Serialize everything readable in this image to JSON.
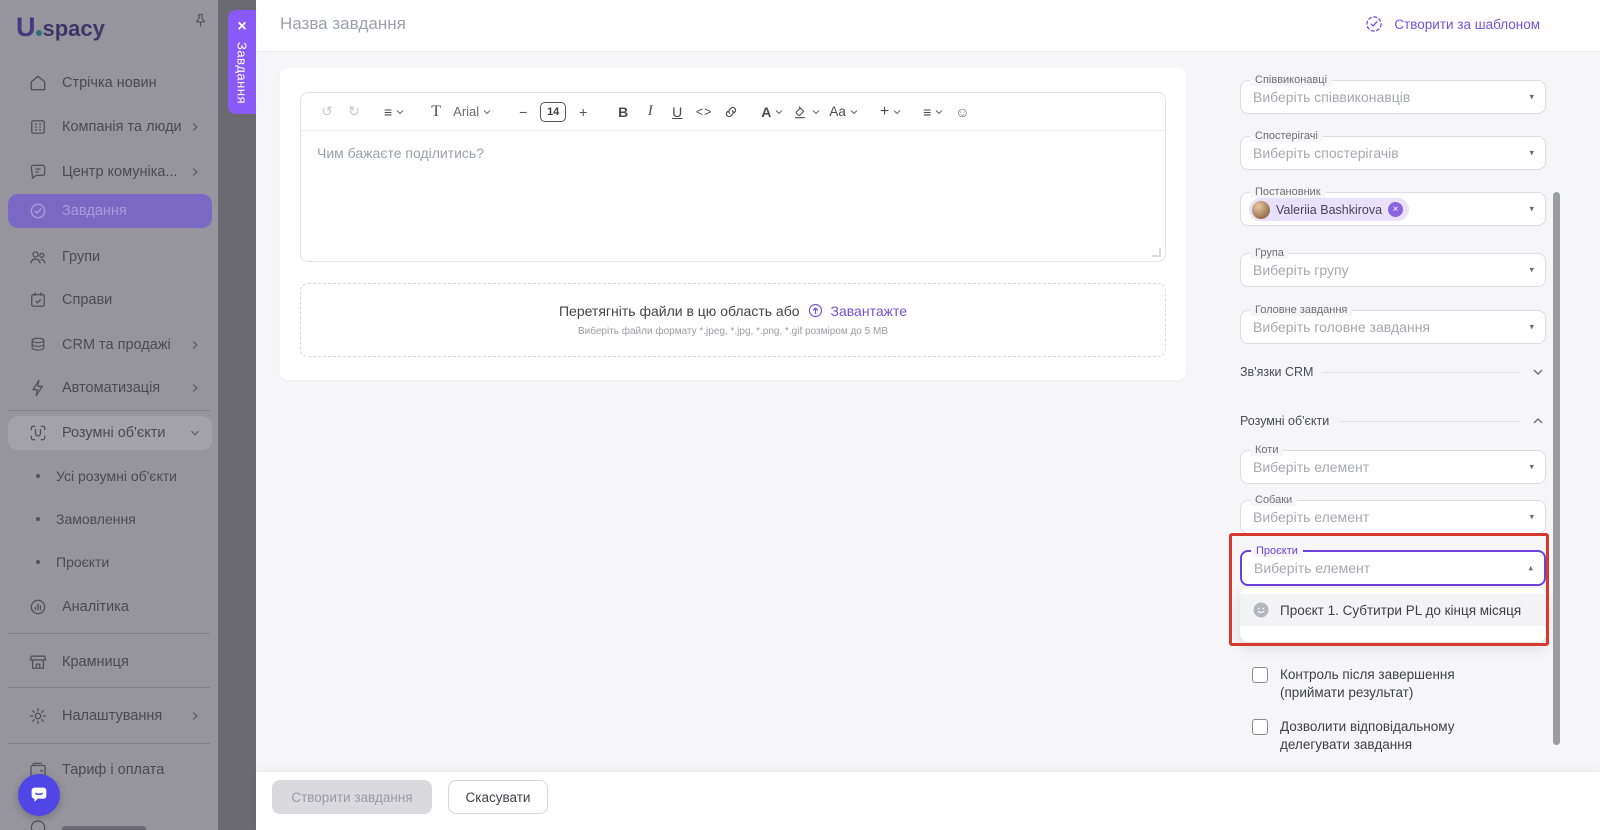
{
  "brand": {
    "logo_letter": "U",
    "logo_rest": "spacy"
  },
  "overlay_tab": {
    "label": "Завдання",
    "close": "×"
  },
  "sidebar": {
    "items": [
      {
        "label": "Стрічка новин"
      },
      {
        "label": "Компанія та люди"
      },
      {
        "label": "Центр комуніка..."
      },
      {
        "label": "Завдання"
      },
      {
        "label": "Групи"
      },
      {
        "label": "Справи"
      },
      {
        "label": "CRM та продажі"
      },
      {
        "label": "Автоматизація"
      },
      {
        "label": "Розумні об'єкти"
      },
      {
        "label": "Усі розумні об'єкти"
      },
      {
        "label": "Замовлення"
      },
      {
        "label": "Проєкти"
      },
      {
        "label": "Аналітика"
      },
      {
        "label": "Крамниця"
      },
      {
        "label": "Налаштування"
      },
      {
        "label": "Тариф і оплата"
      }
    ]
  },
  "header": {
    "title_placeholder": "Назва завдання",
    "template_button": "Створити за шаблоном"
  },
  "editor": {
    "toolbar": {
      "undo": "↺",
      "redo": "↻",
      "align": "≡",
      "font_name": "Arial",
      "minus": "−",
      "font_size": "14",
      "plus": "+",
      "bold": "B",
      "italic": "I",
      "underline": "U",
      "code": "<>",
      "text_color": "A",
      "text_style": "Aa",
      "insert": "+",
      "list": "≡",
      "emoji": "☺"
    },
    "placeholder": "Чим бажаєте поділитись?"
  },
  "dropzone": {
    "text": "Перетягніть файли в цю область або",
    "link": "Завантажте",
    "hint": "Виберіть файли формату *.jpeg, *.jpg, *.png, *.gif розміром до 5 MB"
  },
  "panel": {
    "fields": [
      {
        "label": "Співвиконавці",
        "placeholder": "Виберіть співвиконавців"
      },
      {
        "label": "Спостерігачі",
        "placeholder": "Виберіть спостерігачів"
      },
      {
        "label": "Постановник",
        "value": "Valeriia Bashkirova"
      },
      {
        "label": "Група",
        "placeholder": "Виберіть групу"
      },
      {
        "label": "Головне завдання",
        "placeholder": "Виберіть головне завдання"
      },
      {
        "label": "Коти",
        "placeholder": "Виберіть елемент"
      },
      {
        "label": "Собаки",
        "placeholder": "Виберіть елемент"
      },
      {
        "label": "Проєкти",
        "placeholder": "Виберіть елемент"
      }
    ],
    "sections": {
      "crm": "Зв'язки CRM",
      "smart": "Розумні об'єкти"
    },
    "dropdown_option": "Проєкт 1. Субтитри PL до кінця місяця",
    "checkboxes": [
      {
        "label": "Контроль після завершення (приймати результат)"
      },
      {
        "label": "Дозволити відповідальному делегувати завдання"
      }
    ]
  },
  "footer": {
    "create": "Створити завдання",
    "cancel": "Скасувати"
  },
  "colors": {
    "accent": "#7452d8",
    "tab": "#8a5af8",
    "annotation": "#d6392d",
    "focus": "#6d42d8",
    "fab": "#4f46e5"
  }
}
